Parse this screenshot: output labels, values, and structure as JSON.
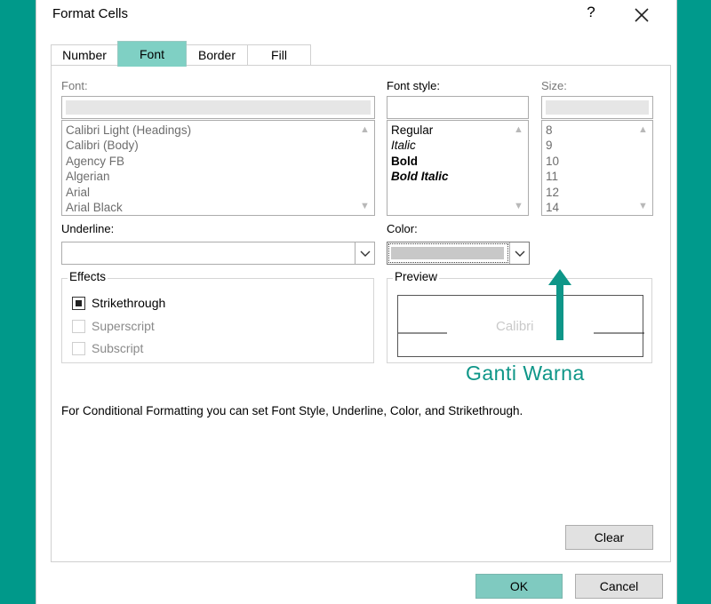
{
  "dialog": {
    "title": "Format Cells",
    "help": "?",
    "icons": {
      "close": "close-icon",
      "scroll_up": "chevron-up-icon",
      "scroll_down": "chevron-down-icon"
    }
  },
  "tabs": [
    {
      "label": "Number",
      "active": false
    },
    {
      "label": "Font",
      "active": true
    },
    {
      "label": "Border",
      "active": false
    },
    {
      "label": "Fill",
      "active": false
    }
  ],
  "font": {
    "label": "Font:",
    "value": "",
    "items": [
      "Calibri Light (Headings)",
      "Calibri (Body)",
      "Agency FB",
      "Algerian",
      "Arial",
      "Arial Black"
    ]
  },
  "font_style": {
    "label": "Font style:",
    "value": "",
    "items": [
      "Regular",
      "Italic",
      "Bold",
      "Bold Italic"
    ]
  },
  "size": {
    "label": "Size:",
    "value": "",
    "items": [
      "8",
      "9",
      "10",
      "11",
      "12",
      "14"
    ]
  },
  "underline": {
    "label": "Underline:",
    "value": ""
  },
  "color": {
    "label": "Color:",
    "value_color": "#c8c8c8"
  },
  "effects": {
    "label": "Effects",
    "strikethrough": {
      "label": "Strikethrough",
      "checked": true
    },
    "superscript": {
      "label": "Superscript",
      "checked": false
    },
    "subscript": {
      "label": "Subscript",
      "checked": false
    }
  },
  "preview": {
    "label": "Preview",
    "text": "Calibri"
  },
  "note": "For Conditional Formatting you can set Font Style, Underline, Color, and Strikethrough.",
  "buttons": {
    "clear": "Clear",
    "ok": "OK",
    "cancel": "Cancel"
  },
  "annotation": {
    "text": "Ganti Warna",
    "color": "#0e9688"
  },
  "colors": {
    "accent": "#7fd0c4",
    "background": "#009a8c"
  }
}
